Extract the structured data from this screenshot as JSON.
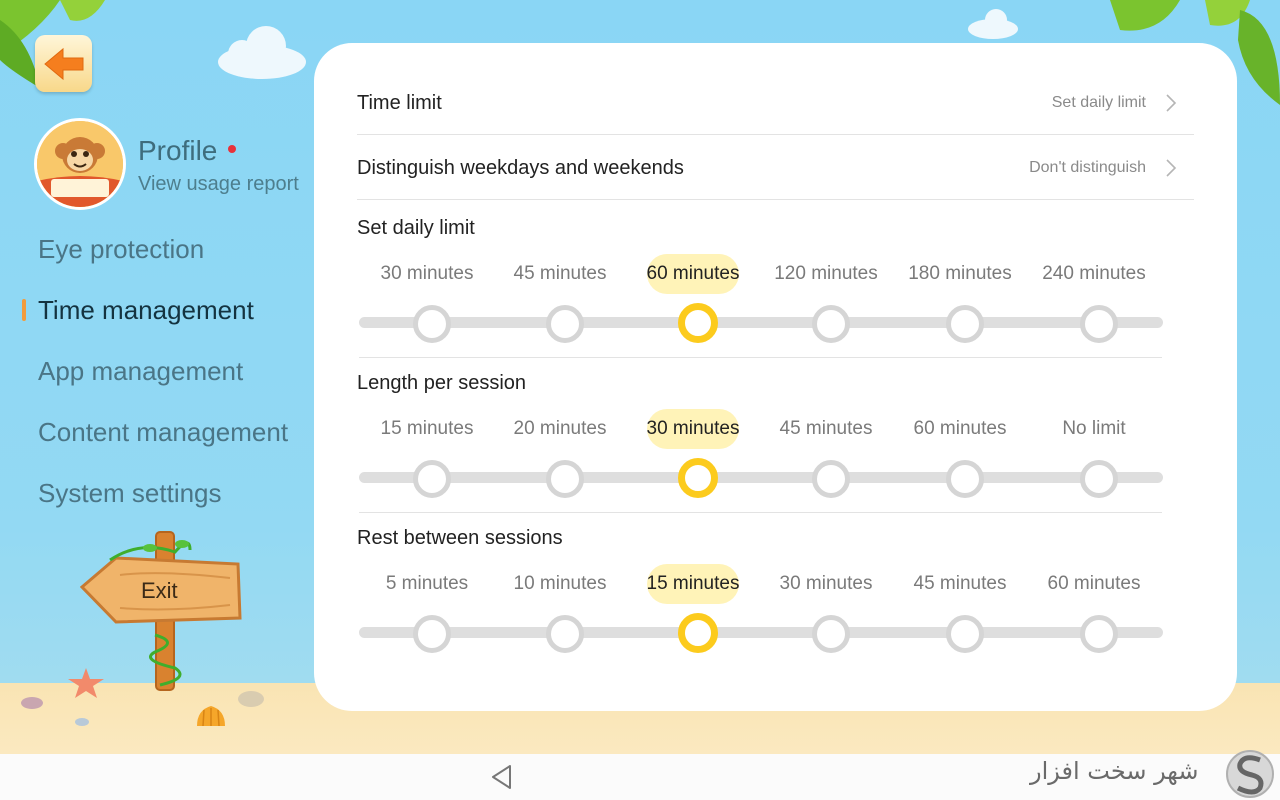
{
  "sidebar": {
    "profile_title": "Profile",
    "profile_subtitle": "View usage report",
    "items": [
      {
        "label": "Eye protection",
        "active": false
      },
      {
        "label": "Time management",
        "active": true
      },
      {
        "label": "App management",
        "active": false
      },
      {
        "label": "Content management",
        "active": false
      },
      {
        "label": "System settings",
        "active": false
      }
    ],
    "exit_label": "Exit"
  },
  "settings": {
    "time_limit": {
      "label": "Time limit",
      "value": "Set daily limit"
    },
    "weekdays": {
      "label": "Distinguish weekdays and weekends",
      "value": "Don't distinguish"
    }
  },
  "sliders": [
    {
      "label": "Set daily limit",
      "options": [
        "30 minutes",
        "45 minutes",
        "60 minutes",
        "120 minutes",
        "180 minutes",
        "240 minutes"
      ],
      "selected_index": 2
    },
    {
      "label": "Length per session",
      "options": [
        "15 minutes",
        "20 minutes",
        "30 minutes",
        "45 minutes",
        "60 minutes",
        "No limit"
      ],
      "selected_index": 2
    },
    {
      "label": "Rest between sessions",
      "options": [
        "5 minutes",
        "10 minutes",
        "15 minutes",
        "30 minutes",
        "45 minutes",
        "60 minutes"
      ],
      "selected_index": 2
    }
  ],
  "watermark": "شهر سخت افزار",
  "colors": {
    "accent": "#fccb1d",
    "highlight": "#fff3b8",
    "active_marker": "#f29c3d",
    "badge": "#e8323a"
  }
}
